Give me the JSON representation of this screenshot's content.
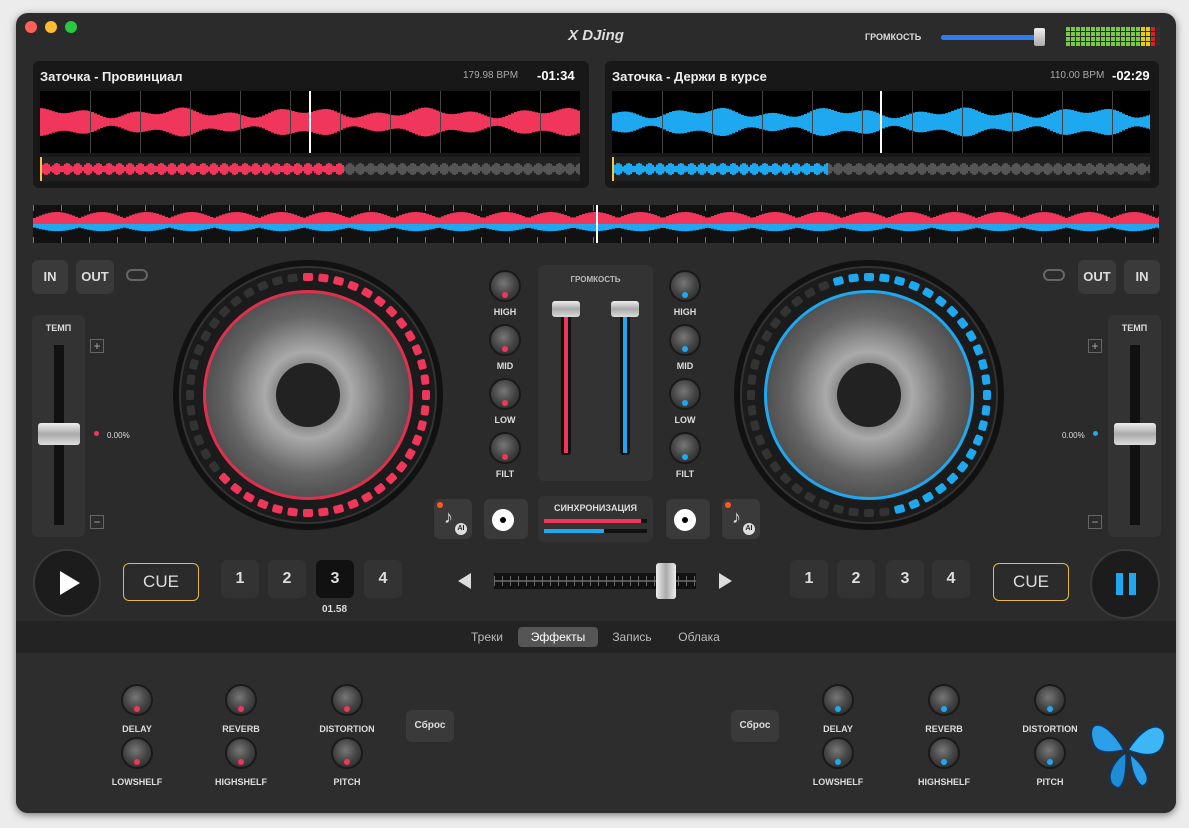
{
  "app": {
    "title": "X DJing",
    "volume_label": "ГРОМКОСТЬ"
  },
  "deck_left": {
    "track": "Заточка - Провинциал",
    "bpm": "179.98 BPM",
    "time": "-01:34",
    "in": "IN",
    "out": "OUT",
    "tempo_label": "ТЕМП",
    "tempo_value": "0.00%",
    "cue": "CUE",
    "pads": [
      "1",
      "2",
      "3",
      "4"
    ],
    "active_pad_time": "01.58",
    "color": "#f0365a"
  },
  "deck_right": {
    "track": "Заточка - Держи в курсе",
    "bpm": "110.00 BPM",
    "time": "-02:29",
    "in": "IN",
    "out": "OUT",
    "tempo_label": "ТЕМП",
    "tempo_value": "0.00%",
    "cue": "CUE",
    "pads": [
      "1",
      "2",
      "3",
      "4"
    ],
    "color": "#1ea8f0"
  },
  "mixer": {
    "volume_label": "ГРОМКОСТЬ",
    "eq": [
      "HIGH",
      "MID",
      "LOW",
      "FILT"
    ],
    "sync_label": "СИНХРОНИЗАЦИЯ",
    "plus": "+",
    "minus": "−"
  },
  "tabs": [
    "Треки",
    "Эффекты",
    "Запись",
    "Облака"
  ],
  "active_tab": "Эффекты",
  "effects": {
    "row1": [
      "DELAY",
      "REVERB",
      "DISTORTION"
    ],
    "row2": [
      "LOWSHELF",
      "HIGHSHELF",
      "PITCH"
    ],
    "reset": "Сброс"
  },
  "ai_label": "AI"
}
